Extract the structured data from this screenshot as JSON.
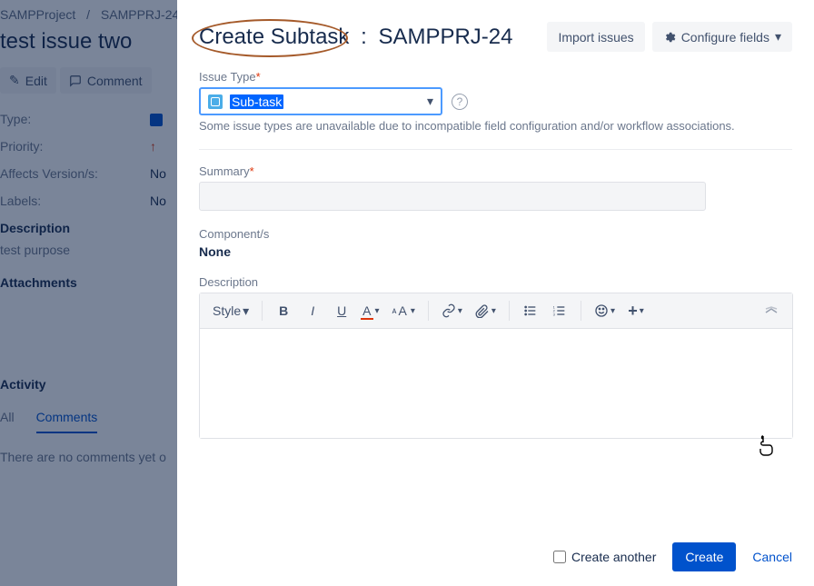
{
  "bg": {
    "breadcrumb": {
      "project": "SAMPProject",
      "sep": "/",
      "issue": "SAMPPRJ-24"
    },
    "title": "test issue two",
    "toolbar": {
      "edit": "Edit",
      "comment": "Comment"
    },
    "fields": {
      "type_label": "Type:",
      "priority_label": "Priority:",
      "affects_label": "Affects Version/s:",
      "affects_value": "No",
      "labels_label": "Labels:",
      "labels_value": "No"
    },
    "description": {
      "heading": "Description",
      "text": "test purpose"
    },
    "attachments_heading": "Attachments",
    "activity": {
      "heading": "Activity",
      "tabs": {
        "all": "All",
        "comments": "Comments"
      }
    },
    "no_comments": "There are no comments yet o"
  },
  "modal": {
    "title_action": "Create Subtask",
    "title_issue": "SAMPPRJ-24",
    "import_label": "Import issues",
    "configure_label": "Configure fields",
    "issue_type": {
      "label": "Issue Type",
      "value": "Sub-task",
      "help": "Some issue types are unavailable due to incompatible field configuration and/or workflow associations."
    },
    "summary": {
      "label": "Summary",
      "value": ""
    },
    "components": {
      "label": "Component/s",
      "value": "None"
    },
    "description": {
      "label": "Description"
    },
    "toolbar": {
      "style": "Style",
      "bold": "B",
      "italic": "I",
      "underline": "U",
      "color": "A",
      "clear": "ᴀA"
    },
    "footer": {
      "create_another": "Create another",
      "create": "Create",
      "cancel": "Cancel"
    }
  }
}
